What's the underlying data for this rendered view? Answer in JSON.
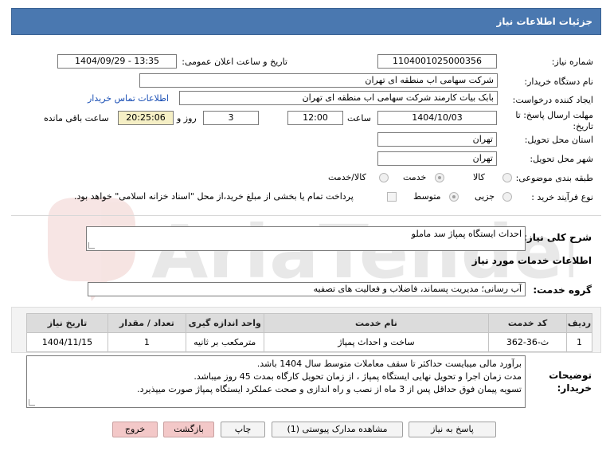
{
  "header": {
    "title": "جزئیات اطلاعات نیاز"
  },
  "form": {
    "need_number": {
      "label": "شماره نیاز:",
      "value": "1104001025000356"
    },
    "announce_datetime": {
      "label": "تاریخ و ساعت اعلان عمومی:",
      "value": "1404/09/29 - 13:35"
    },
    "buyer_org": {
      "label": "نام دستگاه خریدار:",
      "value": "شرکت سهامی اب منطقه ای تهران"
    },
    "requester": {
      "label": "ایجاد کننده درخواست:",
      "value": "بابک بیات کارمند شرکت سهامی اب منطقه ای تهران",
      "contact_link": "اطلاعات تماس خریدار"
    },
    "deadline": {
      "label": "مهلت ارسال پاسخ: تا تاریخ:",
      "date": "1404/10/03",
      "time_label": "ساعت",
      "time": "12:00",
      "days": "3",
      "days_label": "روز و",
      "remaining": "20:25:06",
      "remaining_label": "ساعت باقی مانده"
    },
    "province": {
      "label": "استان محل تحویل:",
      "value": "تهران"
    },
    "city": {
      "label": "شهر محل تحویل:",
      "value": "تهران"
    },
    "category": {
      "label": "طبقه بندی موضوعی:",
      "options": [
        "کالا",
        "خدمت",
        "کالا/خدمت"
      ],
      "selected": "خدمت"
    },
    "purchase_process": {
      "label": "نوع فرآیند خرید :",
      "options": [
        "جزیی",
        "متوسط"
      ],
      "selected": "متوسط",
      "treasury_note": "پرداخت تمام یا بخشی از مبلغ خرید،از محل \"اسناد خزانه اسلامی\" خواهد بود."
    }
  },
  "need_summary": {
    "label": "شرح کلی نیاز:",
    "value": "احداث ایستگاه پمپاژ سد ماملو"
  },
  "services_info": {
    "title": "اطلاعات خدمات مورد نیاز"
  },
  "service_group": {
    "label": "گروه خدمت:",
    "value": "آب رسانی؛ مدیریت پسماند، فاضلاب و فعالیت های تصفیه"
  },
  "table": {
    "headers": [
      "ردیف",
      "کد خدمت",
      "نام خدمت",
      "واحد اندازه گیری",
      "تعداد / مقدار",
      "تاریخ نیاز"
    ],
    "rows": [
      [
        "1",
        "ث-36-362",
        "ساخت و احداث پمپاژ",
        "مترمکعب بر ثانیه",
        "1",
        "1404/11/15"
      ]
    ]
  },
  "buyer_notes": {
    "label": "توضیحات خریدار:",
    "lines": [
      "برآورد مالی میبایست حداکثر تا سقف معاملات متوسط سال 1404 باشد.",
      "مدت زمان اجرا و تحویل نهایی ایستگاه پمپاژ ، از زمان تحویل کارگاه بمدت 45 روز میباشد.",
      "تسویه پیمان فوق حداقل پس از 3 ماه از نصب و راه اندازی و صحت عملکرد ایستگاه پمپاژ صورت میپذیرد."
    ]
  },
  "buttons": {
    "reply": "پاسخ به نیاز",
    "documents": "مشاهده مدارک پیوستی (1)",
    "print": "چاپ",
    "back": "بازگشت",
    "exit": "خروج"
  },
  "colors": {
    "header": "#4a78b0",
    "link": "#1a4fb5",
    "remaining_bg": "#f5efc5",
    "exit_bg": "#f3c8c8"
  }
}
